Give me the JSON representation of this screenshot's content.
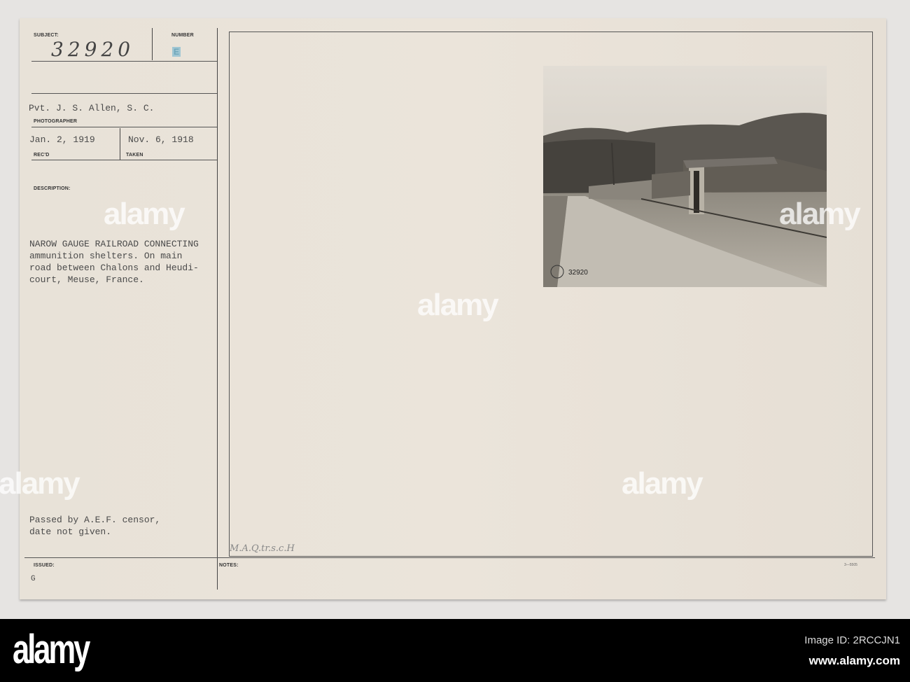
{
  "card": {
    "subject_label": "SUBJECT:",
    "subject_number": "32920",
    "number_label": "NUMBER",
    "number_stamp": "E",
    "photographer": "Pvt. J. S. Allen, S. C.",
    "photographer_label": "PHOTOGRAPHER",
    "received_date": "Jan. 2, 1919",
    "received_label": "REC'D",
    "taken_date": "Nov. 6, 1918",
    "taken_label": "TAKEN",
    "description_label": "DESCRIPTION:",
    "description_lines": [
      "NAROW GAUGE RAILROAD CONNECTING",
      "ammunition shelters. On main",
      "road between Chalons and Heudi-",
      "court, Meuse, France."
    ],
    "censor_lines": [
      "Passed by A.E.F. censor,",
      "date not given."
    ],
    "issued_label": "ISSUED:",
    "issued_value": "G",
    "notes_label": "NOTES:",
    "handwritten_note": "M.A.Q.tr.s.c.H",
    "form_number": "3—5505",
    "photo_caption": "32920"
  },
  "watermark": {
    "word": "alamy",
    "letter": "a"
  },
  "footer": {
    "logo": "alamy",
    "image_id": "Image ID: 2RCCJN1",
    "url": "www.alamy.com"
  }
}
